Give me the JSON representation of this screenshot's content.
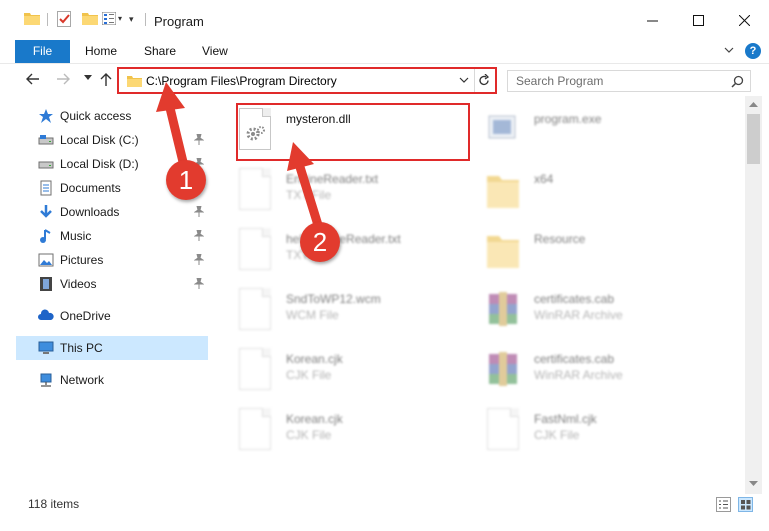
{
  "window": {
    "title": "Program",
    "accent": "#1979ca"
  },
  "ribbon": {
    "tabs": [
      "File",
      "Home",
      "Share",
      "View"
    ],
    "help": "?"
  },
  "address": {
    "path": "C:\\Program Files\\Program Directory"
  },
  "search": {
    "placeholder": "Search Program"
  },
  "sidebar": {
    "items": [
      {
        "label": "Quick access",
        "icon": "star-icon",
        "pinned": false
      },
      {
        "label": "Local Disk (C:)",
        "icon": "drive-icon",
        "pinned": true
      },
      {
        "label": "Local Disk (D:)",
        "icon": "drive-icon",
        "pinned": true
      },
      {
        "label": "Documents",
        "icon": "documents-icon",
        "pinned": true
      },
      {
        "label": "Downloads",
        "icon": "download-icon",
        "pinned": true
      },
      {
        "label": "Music",
        "icon": "music-icon",
        "pinned": true
      },
      {
        "label": "Pictures",
        "icon": "pictures-icon",
        "pinned": true
      },
      {
        "label": "Videos",
        "icon": "videos-icon",
        "pinned": true
      },
      {
        "label": "OneDrive",
        "icon": "cloud-icon",
        "pinned": false
      },
      {
        "label": "This PC",
        "icon": "computer-icon",
        "pinned": false,
        "selected": true
      },
      {
        "label": "Network",
        "icon": "network-icon",
        "pinned": false
      }
    ]
  },
  "files": {
    "left": [
      {
        "name": "mysteron.dll",
        "type": "",
        "icon": "dll-file-icon",
        "highlighted": true
      },
      {
        "name": "EngineReader.txt",
        "type": "TXT File",
        "icon": "text-file-icon"
      },
      {
        "name": "helpEngineReader.txt",
        "type": "TXT File",
        "icon": "text-file-icon"
      },
      {
        "name": "SndToWP12.wcm",
        "type": "WCM File",
        "icon": "file-icon"
      },
      {
        "name": "Korean.cjk",
        "type": "CJK File",
        "icon": "file-icon"
      },
      {
        "name": "Korean.cjk",
        "type": "CJK File",
        "icon": "file-icon"
      }
    ],
    "right": [
      {
        "name": "program.exe",
        "type": "",
        "icon": "exe-file-icon"
      },
      {
        "name": "x64",
        "type": "",
        "icon": "folder-icon"
      },
      {
        "name": "Resource",
        "type": "",
        "icon": "folder-icon"
      },
      {
        "name": "certificates.cab",
        "type": "WinRAR Archive",
        "icon": "winrar-icon"
      },
      {
        "name": "certificates.cab",
        "type": "WinRAR Archive",
        "icon": "winrar-icon"
      },
      {
        "name": "FastNml.cjk",
        "type": "CJK File",
        "icon": "file-icon"
      }
    ]
  },
  "status": {
    "count": "118 items"
  },
  "callouts": [
    "1",
    "2"
  ]
}
